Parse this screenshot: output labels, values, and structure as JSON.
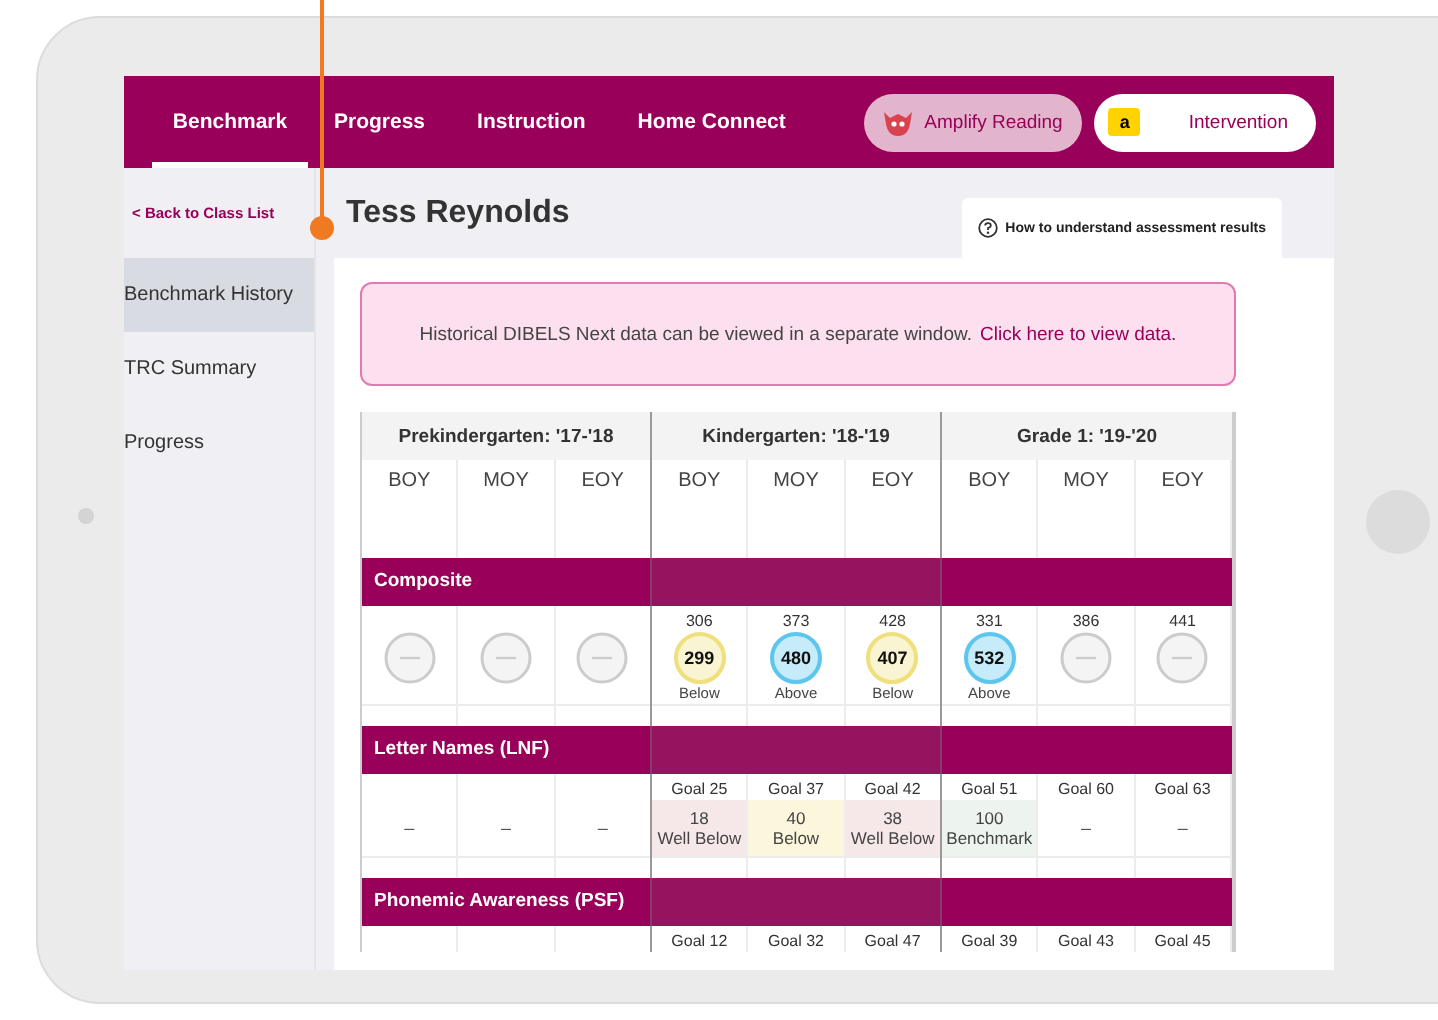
{
  "nav": {
    "tabs": [
      {
        "label": "Benchmark",
        "selected": true
      },
      {
        "label": "Progress",
        "selected": false
      },
      {
        "label": "Instruction",
        "selected": false
      },
      {
        "label": "Home Connect",
        "selected": false
      }
    ],
    "programs": [
      {
        "label": "Amplify Reading",
        "kind": "amplify",
        "selected": true
      },
      {
        "label": "Intervention",
        "kind": "intervention",
        "badge": "a",
        "selected": false
      }
    ]
  },
  "back_link": "< Back to Class List",
  "student_name": "Tess Reynolds",
  "help_button": "How to understand assessment results",
  "sidebar": {
    "items": [
      {
        "label": "Benchmark History",
        "selected": true
      },
      {
        "label": "TRC Summary",
        "selected": false
      },
      {
        "label": "Progress",
        "selected": false
      }
    ]
  },
  "banner": {
    "text": "Historical DIBELS Next data can be viewed in a separate window.",
    "link": "Click here to view data."
  },
  "table": {
    "groups": [
      {
        "title": "Prekindergarten: '17-'18",
        "highlighted": false,
        "periods": [
          "BOY",
          "MOY",
          "EOY"
        ]
      },
      {
        "title": "Kindergarten: '18-'19",
        "highlighted": true,
        "periods": [
          "BOY",
          "MOY",
          "EOY"
        ]
      },
      {
        "title": "Grade 1: '19-'20",
        "highlighted": false,
        "periods": [
          "BOY",
          "MOY",
          "EOY"
        ]
      }
    ],
    "sections": [
      {
        "title": "Composite",
        "kind": "composite",
        "cells": [
          {
            "kind": "empty"
          },
          {
            "kind": "empty"
          },
          {
            "kind": "empty"
          },
          {
            "kind": "score",
            "goal": "306",
            "score": "299",
            "status": "Below",
            "color": "#efe07c"
          },
          {
            "kind": "score",
            "goal": "373",
            "score": "480",
            "status": "Above",
            "color": "#5cc6ef"
          },
          {
            "kind": "score",
            "goal": "428",
            "score": "407",
            "status": "Below",
            "color": "#efe07c"
          },
          {
            "kind": "score",
            "goal": "331",
            "score": "532",
            "status": "Above",
            "color": "#5cc6ef"
          },
          {
            "kind": "empty",
            "goal": "386"
          },
          {
            "kind": "empty",
            "goal": "441"
          }
        ]
      },
      {
        "title": "Letter Names (LNF)",
        "kind": "measure",
        "cells": [
          {
            "kind": "none",
            "text": "–"
          },
          {
            "kind": "none",
            "text": "–"
          },
          {
            "kind": "none",
            "text": "–"
          },
          {
            "kind": "score",
            "goal": "Goal 25",
            "score": "18",
            "status": "Well Below",
            "color": "#f6e8e9"
          },
          {
            "kind": "score",
            "goal": "Goal 37",
            "score": "40",
            "status": "Below",
            "color": "#fbf6dc"
          },
          {
            "kind": "score",
            "goal": "Goal 42",
            "score": "38",
            "status": "Well Below",
            "color": "#f6e8e9"
          },
          {
            "kind": "score",
            "goal": "Goal 51",
            "score": "100",
            "status": "Benchmark",
            "color": "#edf3ee"
          },
          {
            "kind": "none",
            "goal": "Goal 60",
            "text": "–"
          },
          {
            "kind": "none",
            "goal": "Goal 63",
            "text": "–"
          }
        ]
      },
      {
        "title": "Phonemic Awareness (PSF)",
        "kind": "partial",
        "cells": [
          {
            "kind": "blank"
          },
          {
            "kind": "blank"
          },
          {
            "kind": "blank"
          },
          {
            "kind": "goal",
            "goal": "Goal 12"
          },
          {
            "kind": "goal",
            "goal": "Goal 32"
          },
          {
            "kind": "goal",
            "goal": "Goal 47"
          },
          {
            "kind": "goal",
            "goal": "Goal 39"
          },
          {
            "kind": "goal",
            "goal": "Goal 43"
          },
          {
            "kind": "goal",
            "goal": "Goal 45"
          }
        ]
      }
    ]
  }
}
